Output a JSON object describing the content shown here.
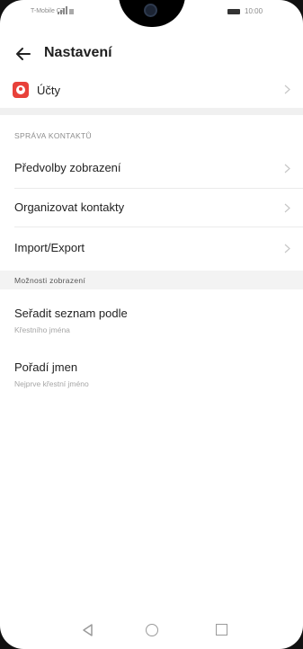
{
  "status_bar": {
    "carrier": "T-Mobile CZ",
    "time": "10:00"
  },
  "header": {
    "title": "Nastavení"
  },
  "accounts": {
    "label": "Účty",
    "icon": "account-icon",
    "icon_color": "#e8413a"
  },
  "sections": {
    "contacts_header": "SPRÁVA KONTAKTŮ",
    "display_header": "Možnosti zobrazení"
  },
  "items": [
    {
      "label": "Předvolby zobrazení"
    },
    {
      "label": "Organizovat kontakty"
    },
    {
      "label": "Import/Export"
    }
  ],
  "display_items": [
    {
      "label": "Seřadit seznam podle",
      "sub": "Křestního jména"
    },
    {
      "label": "Pořadí jmen",
      "sub": "Nejprve křestní jméno"
    }
  ]
}
